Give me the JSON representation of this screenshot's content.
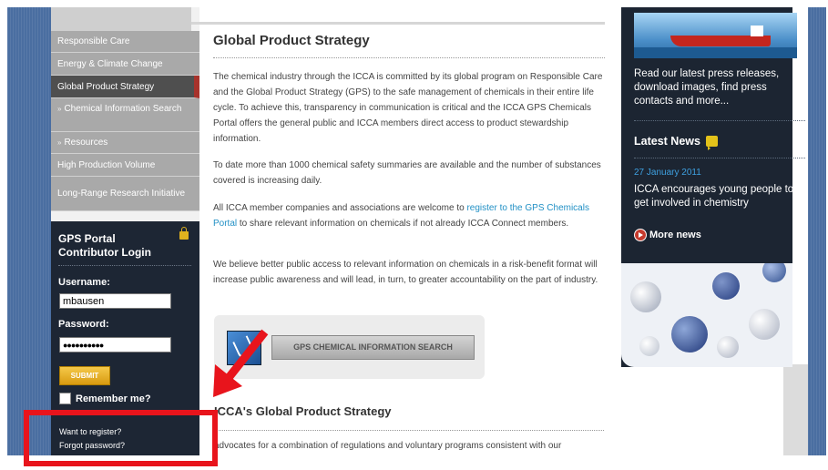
{
  "sidebar": {
    "nav": [
      {
        "label": "Responsible Care",
        "type": "top"
      },
      {
        "label": "Energy & Climate Change",
        "type": "top"
      },
      {
        "label": "Global Product Strategy",
        "type": "active"
      },
      {
        "label": "Chemical Information Search",
        "type": "sub"
      },
      {
        "label": "Resources",
        "type": "sub"
      },
      {
        "label": "High Production Volume",
        "type": "top"
      },
      {
        "label": "Long-Range Research Initiative",
        "type": "top"
      }
    ],
    "login": {
      "title_line1": "GPS Portal",
      "title_line2": "Contributor Login",
      "username_label": "Username:",
      "username_value": "mbausen",
      "password_label": "Password:",
      "password_value": "●●●●●●●●●●",
      "submit_label": "SUBMIT",
      "remember_label": "Remember me?",
      "register_link": "Want to register?",
      "forgot_link": "Forgot password?"
    }
  },
  "main": {
    "title": "Global Product Strategy",
    "p1": "The chemical industry through the ICCA is committed by its global program on Responsible Care and the Global Product Strategy (GPS) to the safe management of chemicals in their entire life cycle. To achieve this, transparency in communication is critical and the ICCA GPS Chemicals Portal offers the general public and ICCA members direct access to product stewardship information.",
    "p2": "To date more than 1000 chemical safety summaries are available and the number of substances covered is increasing daily.",
    "p3_before": "All ICCA member companies and associations are welcome to ",
    "p3_link": "register to the GPS Chemicals Portal",
    "p3_after": " to share relevant information on chemicals if not already ICCA Connect members.",
    "p4": "We believe better public access to relevant information on chemicals in a risk-benefit format will increase public awareness and will lead, in turn, to greater accountability on the part of industry.",
    "search_button": "GPS CHEMICAL INFORMATION SEARCH",
    "h2": "ICCA's Global Product Strategy",
    "p5": "advocates for a combination of regulations and voluntary programs consistent with our"
  },
  "right": {
    "press_text": "Read our latest press releases, download images, find press contacts and more...",
    "latest_news": "Latest News",
    "news_date": "27 January 2011",
    "news_text": "ICCA encourages young people to get involved in chemistry",
    "more_news": "More news"
  },
  "colors": {
    "sidebar_dark": "#1d2634",
    "nav_gray": "#a9a9a9",
    "active_marker": "#a8322b",
    "link_blue": "#2190c5",
    "annotation_red": "#e8141c"
  }
}
